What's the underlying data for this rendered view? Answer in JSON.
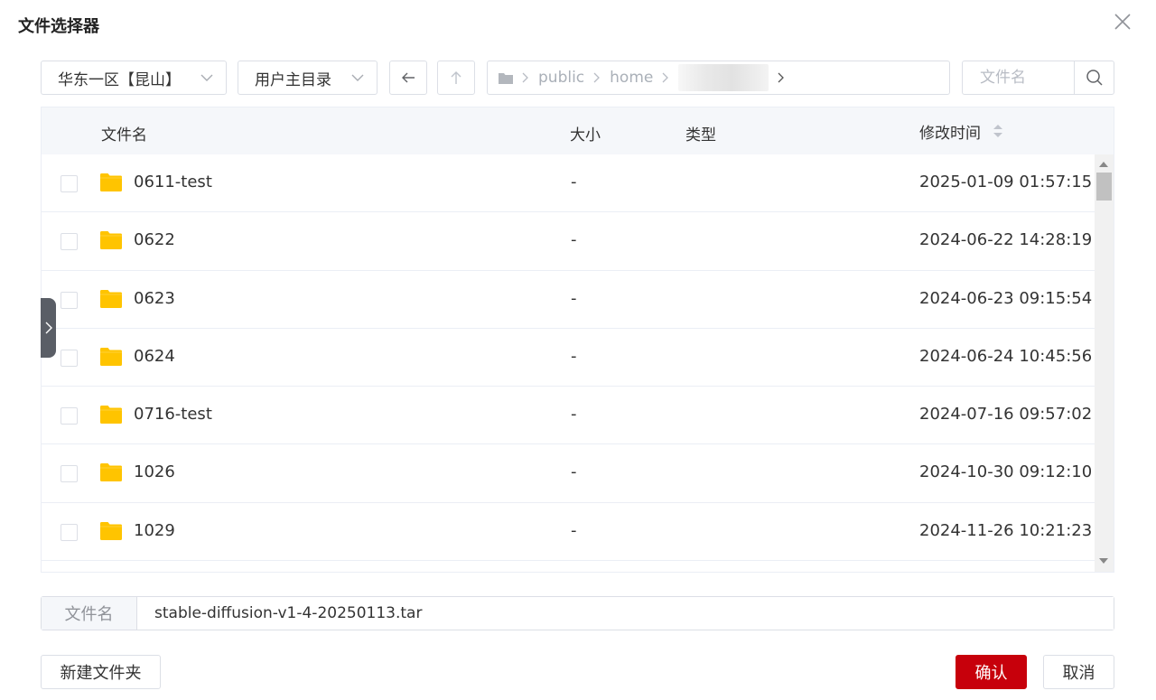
{
  "dialog": {
    "title": "文件选择器"
  },
  "toolbar": {
    "region_select": "华东一区【昆山】",
    "dir_select": "用户主目录",
    "breadcrumb": [
      "public",
      "home"
    ],
    "search_placeholder": "文件名"
  },
  "table": {
    "headers": {
      "name": "文件名",
      "size": "大小",
      "type": "类型",
      "modified": "修改时间"
    },
    "rows": [
      {
        "name": "0611-test",
        "size": "-",
        "type": "",
        "modified": "2025-01-09 01:57:15"
      },
      {
        "name": "0622",
        "size": "-",
        "type": "",
        "modified": "2024-06-22 14:28:19"
      },
      {
        "name": "0623",
        "size": "-",
        "type": "",
        "modified": "2024-06-23 09:15:54"
      },
      {
        "name": "0624",
        "size": "-",
        "type": "",
        "modified": "2024-06-24 10:45:56"
      },
      {
        "name": "0716-test",
        "size": "-",
        "type": "",
        "modified": "2024-07-16 09:57:02"
      },
      {
        "name": "1026",
        "size": "-",
        "type": "",
        "modified": "2024-10-30 09:12:10"
      },
      {
        "name": "1029",
        "size": "-",
        "type": "",
        "modified": "2024-11-26 10:21:23"
      }
    ]
  },
  "filename": {
    "label": "文件名",
    "value": "stable-diffusion-v1-4-20250113.tar"
  },
  "footer": {
    "new_folder": "新建文件夹",
    "confirm": "确认",
    "cancel": "取消"
  },
  "colors": {
    "primary": "#c7000b",
    "folder": "#ffc400",
    "border": "#dcdfe6"
  }
}
